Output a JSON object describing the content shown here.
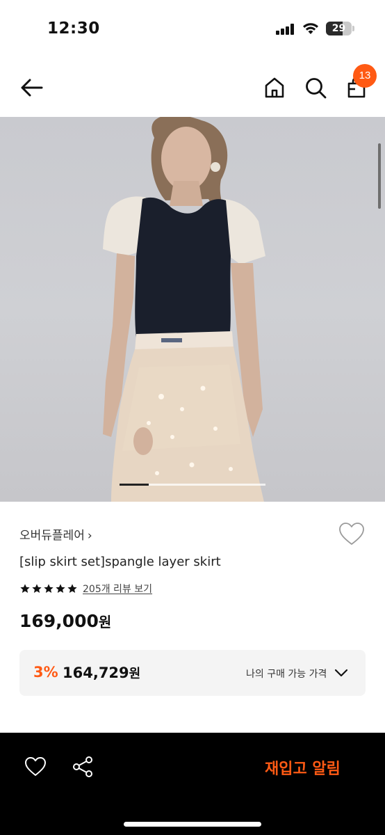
{
  "status_bar": {
    "time": "12:30",
    "battery_level": "29",
    "icons": [
      "signal-icon",
      "wifi-icon",
      "battery-icon"
    ]
  },
  "header": {
    "icons": [
      "back-arrow-icon",
      "home-icon",
      "search-icon",
      "cart-icon"
    ],
    "cart_count": "13"
  },
  "gallery": {
    "image": "product-photo",
    "active_slide_fraction": 0.2
  },
  "product": {
    "brand": "오버듀플레어",
    "brand_chevron": "›",
    "title": "[slip skirt set]spangle layer skirt",
    "rating_stars": 5,
    "review_link": "205개 리뷰 보기",
    "price": "169,000",
    "price_unit": "원"
  },
  "discount": {
    "percent": "3%",
    "price": "164,729",
    "price_unit": "원",
    "label": "나의 구매 가능 가격"
  },
  "bottom_bar": {
    "icons": [
      "heart-icon",
      "share-icon"
    ],
    "restock_label": "재입고 알림"
  },
  "colors": {
    "accent": "#ff5a14",
    "bottom_bar_bg": "#000000",
    "discount_box_bg": "#f4f4f4"
  }
}
